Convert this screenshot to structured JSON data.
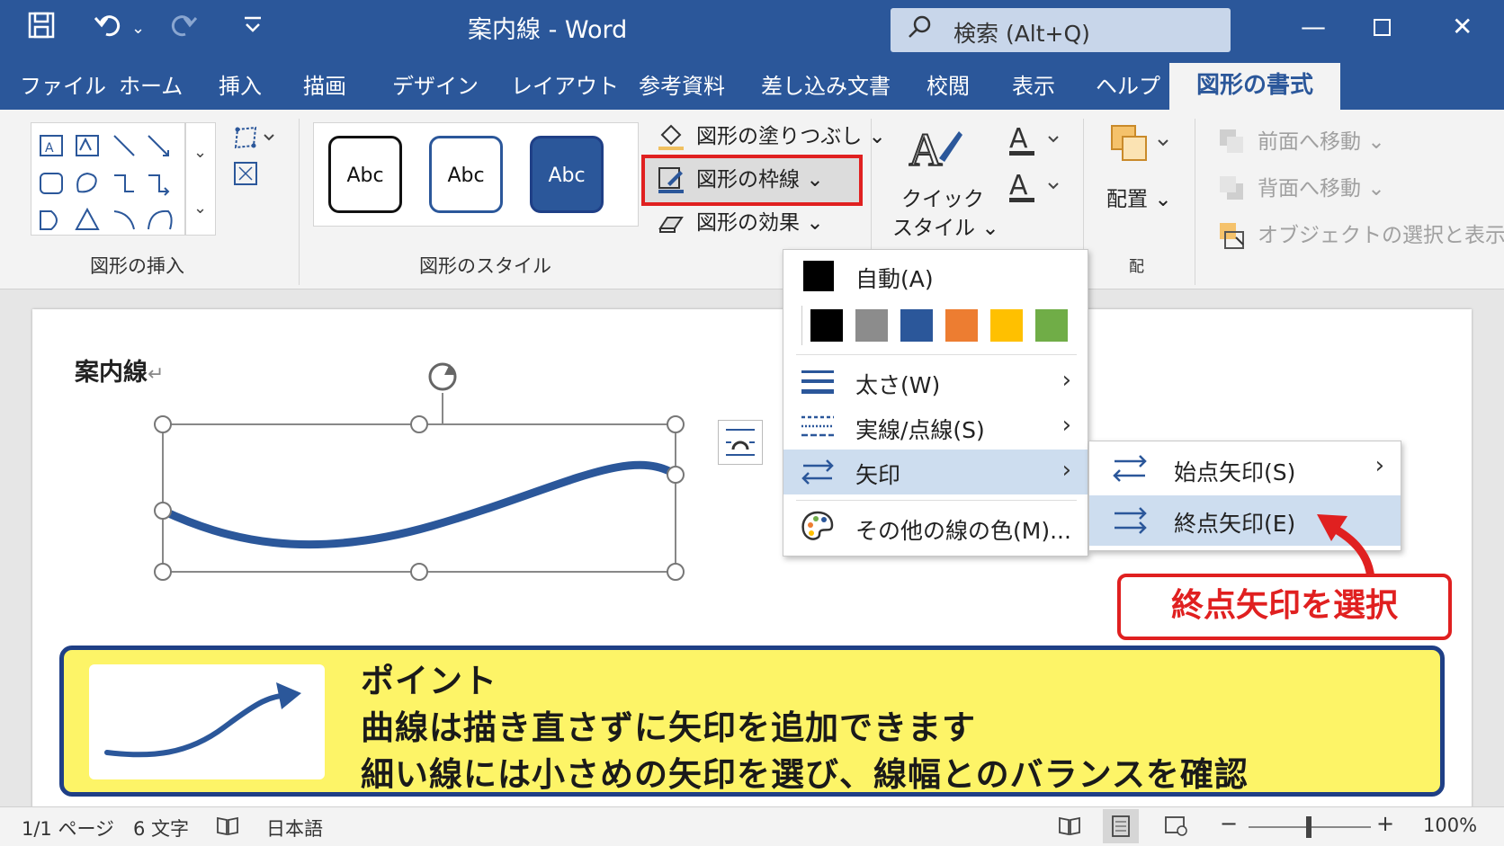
{
  "titlebar": {
    "doc_title": "案内線 - Word",
    "search_placeholder": "検索 (Alt+Q)"
  },
  "tabs": [
    {
      "label": "ファイル"
    },
    {
      "label": "ホーム"
    },
    {
      "label": "挿入"
    },
    {
      "label": "描画"
    },
    {
      "label": "デザイン"
    },
    {
      "label": "レイアウト"
    },
    {
      "label": "参考資料"
    },
    {
      "label": "差し込み文書"
    },
    {
      "label": "校閲"
    },
    {
      "label": "表示"
    },
    {
      "label": "ヘルプ"
    }
  ],
  "active_tab": "図形の書式",
  "ribbon": {
    "insert_group_label": "図形の挿入",
    "style_group_label": "図形のスタイル",
    "style_sample": "Abc",
    "fill_label": "図形の塗りつぶし",
    "outline_label": "図形の枠線",
    "effect_label": "図形の効果",
    "quick_style_line1": "クイック",
    "quick_style_line2": "スタイル",
    "arrange_label": "配置",
    "arrange_group_label": "配",
    "bring_forward": "前面へ移動",
    "send_backward": "背面へ移動",
    "selection_pane": "オブジェクトの選択と表示"
  },
  "document": {
    "heading": "案内線"
  },
  "outline_menu": {
    "auto_label": "自動(A)",
    "swatches": [
      "#000000",
      "#8c8c8c",
      "#2b579a",
      "#ed7d31",
      "#ffc000",
      "#70ad47"
    ],
    "weight_label": "太さ(W)",
    "dash_label": "実線/点線(S)",
    "arrow_label": "矢印",
    "more_colors_label": "その他の線の色(M)..."
  },
  "arrow_submenu": {
    "start_label": "始点矢印(S)",
    "end_label": "終点矢印(E)"
  },
  "callout": {
    "text": "終点矢印を選択"
  },
  "point": {
    "title": "ポイント",
    "line1": "曲線は描き直さずに矢印を追加できます",
    "line2": "細い線には小さめの矢印を選び、線幅とのバランスを確認"
  },
  "status": {
    "page": "1/1 ページ",
    "words": "6 文字",
    "language": "日本語",
    "zoom": "100%"
  },
  "colors": {
    "brand": "#2b579a",
    "highlight": "#e02020",
    "point_bg": "#fdf467",
    "point_border": "#1f3f86"
  }
}
